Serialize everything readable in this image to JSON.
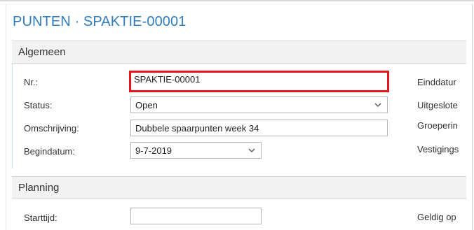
{
  "page": {
    "title": "PUNTEN · SPAKTIE-00001"
  },
  "algemeen": {
    "heading": "Algemeen",
    "fields": {
      "nr_label": "Nr.:",
      "nr_value": "SPAKTIE-00001",
      "status_label": "Status:",
      "status_value": "Open",
      "omschrijving_label": "Omschrijving:",
      "omschrijving_value": "Dubbele spaarpunten week 34",
      "begindatum_label": "Begindatum:",
      "begindatum_value": "9-7-2019"
    },
    "right_labels": {
      "einddatum": "Einddatur",
      "uitgesloten": "Uitgeslote",
      "groepering": "Groeperin",
      "vestigings": "Vestigings"
    }
  },
  "planning": {
    "heading": "Planning",
    "fields": {
      "starttijd_label": "Starttijd:",
      "starttijd_value": ""
    },
    "right_labels": {
      "geldig_op": "Geldig op"
    }
  },
  "colors": {
    "title": "#2f7dc0",
    "highlight_border": "#e8141c",
    "section_band": "#f2f2f2"
  },
  "icons": {
    "chevron": "chevron-down-icon"
  }
}
